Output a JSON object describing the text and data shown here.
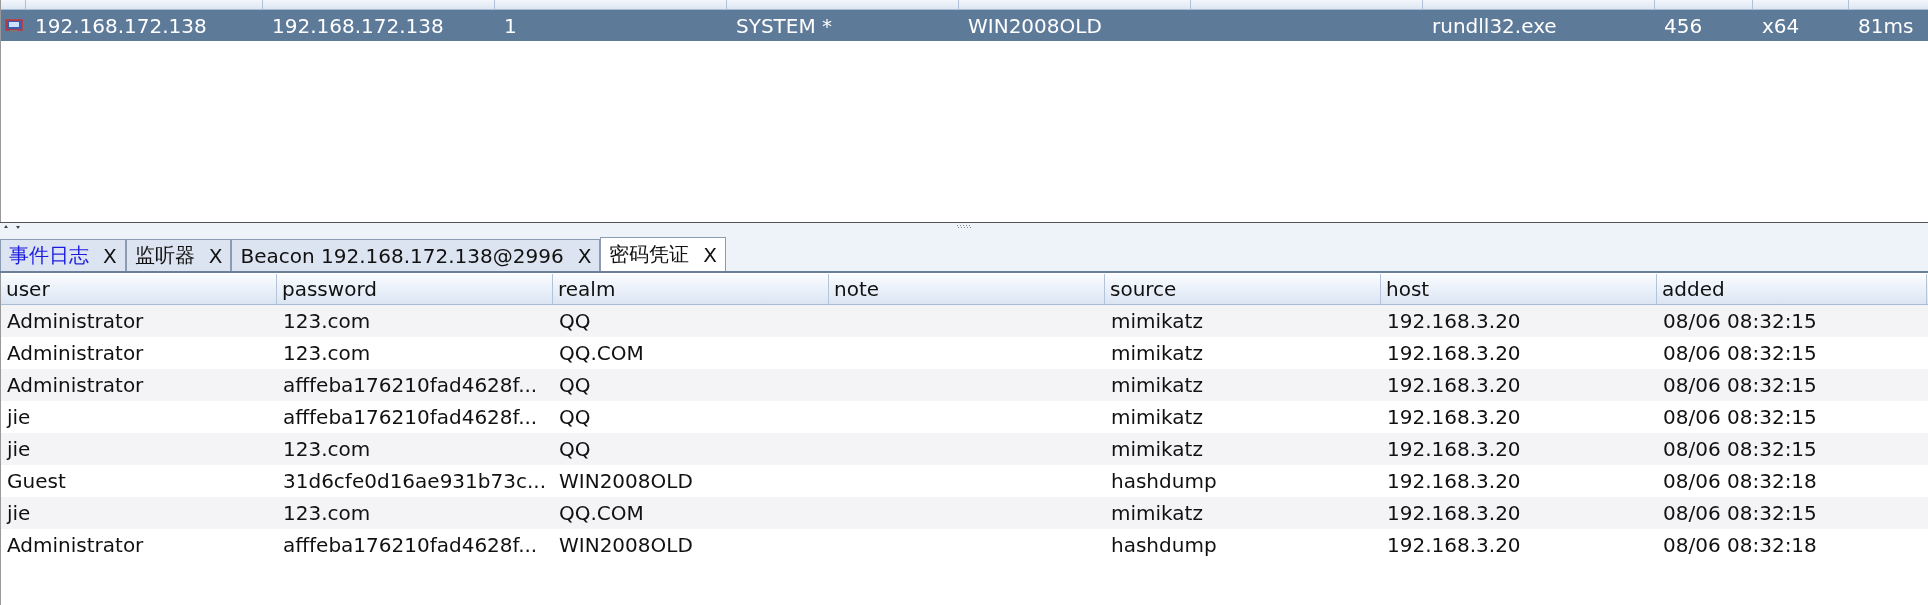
{
  "sessions": {
    "rows": [
      {
        "external": "192.168.172.138",
        "internal": "192.168.172.138",
        "listener": "1",
        "user": "SYSTEM *",
        "computer": "WIN2008OLD",
        "note": "",
        "process": "rundll32.exe",
        "pid": "456",
        "arch": "x64",
        "last": "81ms",
        "selected": true
      }
    ]
  },
  "tabs": [
    {
      "label": "事件日志",
      "close": "X",
      "highlight": true,
      "selected": false
    },
    {
      "label": "监听器",
      "close": "X",
      "highlight": false,
      "selected": false
    },
    {
      "label": "Beacon 192.168.172.138@2996",
      "close": "X",
      "highlight": false,
      "selected": false
    },
    {
      "label": "密码凭证",
      "close": "X",
      "highlight": false,
      "selected": true
    }
  ],
  "credentials": {
    "columns": [
      "user",
      "password",
      "realm",
      "note",
      "source",
      "host",
      "added"
    ],
    "rows": [
      [
        "Administrator",
        "123.com",
        "QQ",
        "",
        "mimikatz",
        "192.168.3.20",
        "08/06 08:32:15"
      ],
      [
        "Administrator",
        "123.com",
        "QQ.COM",
        "",
        "mimikatz",
        "192.168.3.20",
        "08/06 08:32:15"
      ],
      [
        "Administrator",
        "afffeba176210fad4628f...",
        "QQ",
        "",
        "mimikatz",
        "192.168.3.20",
        "08/06 08:32:15"
      ],
      [
        "jie",
        "afffeba176210fad4628f...",
        "QQ",
        "",
        "mimikatz",
        "192.168.3.20",
        "08/06 08:32:15"
      ],
      [
        "jie",
        "123.com",
        "QQ",
        "",
        "mimikatz",
        "192.168.3.20",
        "08/06 08:32:15"
      ],
      [
        "Guest",
        "31d6cfe0d16ae931b73c...",
        "WIN2008OLD",
        "",
        "hashdump",
        "192.168.3.20",
        "08/06 08:32:18"
      ],
      [
        "jie",
        "123.com",
        "QQ.COM",
        "",
        "mimikatz",
        "192.168.3.20",
        "08/06 08:32:15"
      ],
      [
        "Administrator",
        "afffeba176210fad4628f...",
        "WIN2008OLD",
        "",
        "hashdump",
        "192.168.3.20",
        "08/06 08:32:18"
      ]
    ]
  }
}
